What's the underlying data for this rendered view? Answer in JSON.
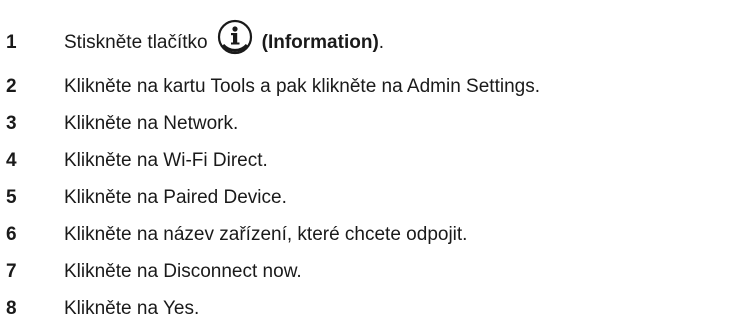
{
  "steps": [
    {
      "number": "1",
      "prefix": "Stiskněte tlačítko",
      "icon": "info-icon",
      "bold": "(Information)",
      "suffix": "."
    },
    {
      "number": "2",
      "text": "Klikněte na kartu Tools a pak klikněte na Admin Settings."
    },
    {
      "number": "3",
      "text": "Klikněte na Network."
    },
    {
      "number": "4",
      "text": "Klikněte na Wi-Fi Direct."
    },
    {
      "number": "5",
      "text": "Klikněte na Paired Device."
    },
    {
      "number": "6",
      "text": "Klikněte na název zařízení, které chcete odpojit."
    },
    {
      "number": "7",
      "text": "Klikněte na Disconnect now."
    },
    {
      "number": "8",
      "text": "Klikněte na Yes."
    }
  ]
}
